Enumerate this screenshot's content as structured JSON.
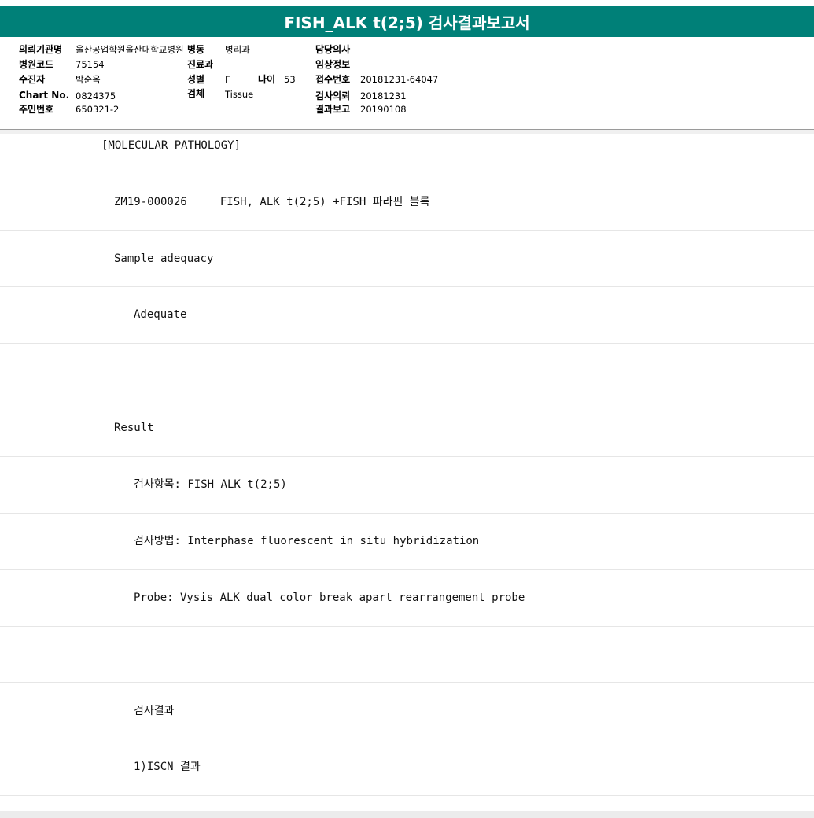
{
  "title": "FISH_ALK t(2;5) 검사결과보고서",
  "header": {
    "institution_label": "의뢰기관명",
    "institution_value": "울산공업학원울산대학교병원",
    "ward_label": "병동",
    "ward_value": "병리과",
    "doctor_label": "담당의사",
    "doctor_value": "",
    "hospital_code_label": "병원코드",
    "hospital_code_value": "75154",
    "dept_label": "진료과",
    "dept_value": "",
    "clinical_info_label": "임상정보",
    "clinical_info_value": "",
    "patient_label": "수진자",
    "patient_value": "박순옥",
    "sex_label": "성별",
    "sex_value": "F",
    "age_label": "나이",
    "age_value": "53",
    "receipt_no_label": "접수번호",
    "receipt_no_value": "20181231-64047",
    "chart_no_label": "Chart No.",
    "chart_no_value": "0824375",
    "specimen_label": "검체",
    "specimen_value": "Tissue",
    "request_date_label": "검사의뢰",
    "request_date_value": "20181231",
    "resident_no_label": "주민번호",
    "resident_no_value": "650321-2",
    "report_date_label": "결과보고",
    "report_date_value": "20190108"
  },
  "report_lines": [
    "[MOLECULAR PATHOLOGY]",
    "ZM19-000026     FISH, ALK t(2;5) +FISH 파라핀 블록",
    "Sample adequacy",
    "Adequate",
    "",
    "Result",
    "검사항목: FISH ALK t(2;5)",
    "검사방법: Interphase fluorescent in situ hybridization",
    "Probe: Vysis ALK dual color break apart rearrangement probe",
    "",
    "검사결과",
    "1)ISCN 결과"
  ]
}
